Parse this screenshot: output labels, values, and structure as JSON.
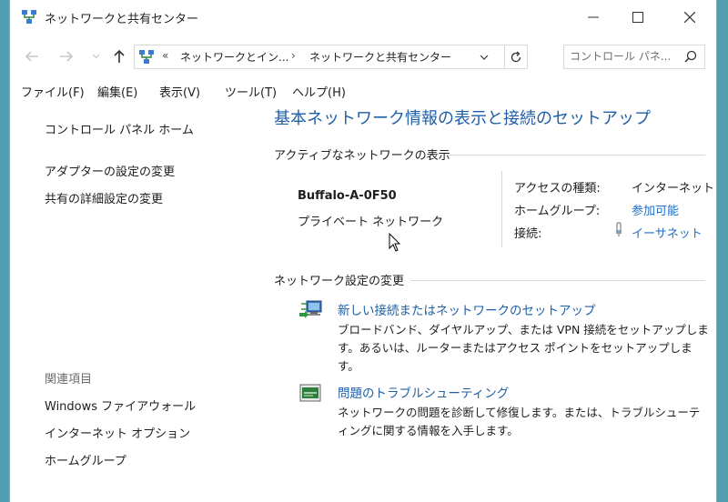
{
  "window": {
    "title": "ネットワークと共有センター",
    "controls": [
      "minimize-icon",
      "maximize-icon",
      "close-icon"
    ]
  },
  "address": {
    "overflow": "«",
    "crumb1": "ネットワークとイン...",
    "separator": "›",
    "crumb2": "ネットワークと共有センター",
    "search_placeholder": "コントロール パネ..."
  },
  "menu": {
    "file": "ファイル(F)",
    "edit": "編集(E)",
    "view": "表示(V)",
    "tools": "ツール(T)",
    "help": "ヘルプ(H)"
  },
  "sidebar": {
    "home": "コントロール パネル ホーム",
    "adapter": "アダプターの設定の変更",
    "advanced": "共有の詳細設定の変更",
    "related_heading": "関連項目",
    "related": [
      "Windows ファイアウォール",
      "インターネット オプション",
      "ホームグループ"
    ]
  },
  "main": {
    "heading": "基本ネットワーク情報の表示と接続のセットアップ",
    "active_section": "アクティブなネットワークの表示",
    "network_name": "Buffalo-A-0F50",
    "network_type": "プライベート ネットワーク",
    "access_label": "アクセスの種類:",
    "access_value": "インターネット",
    "homegroup_label": "ホームグループ:",
    "homegroup_value": "参加可能",
    "connection_label": "接続:",
    "connection_value": "イーサネット",
    "change_section": "ネットワーク設定の変更",
    "task1_link": "新しい接続またはネットワークのセットアップ",
    "task1_desc": "ブロードバンド、ダイヤルアップ、または VPN 接続をセットアップします。あるいは、ルーターまたはアクセス ポイントをセットアップします。",
    "task2_link": "問題のトラブルシューティング",
    "task2_desc": "ネットワークの問題を診断して修復します。または、トラブルシューティングに関する情報を入手します。"
  },
  "colors": {
    "link": "#1e5fa8",
    "desktop": "#4f9fb0"
  }
}
